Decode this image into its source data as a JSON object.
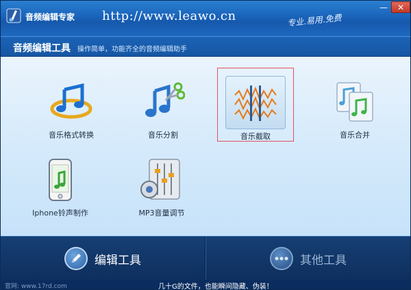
{
  "window": {
    "app_title": "音频编辑专家",
    "url": "http://www.leawo.cn",
    "slogan": "专业.易用.免费",
    "minimize_icon": "minimize-icon",
    "close_icon": "close-icon"
  },
  "header": {
    "title": "音频编辑工具",
    "description": "操作简单，功能齐全的音频编辑助手"
  },
  "tools": [
    {
      "label": "音乐格式转换",
      "icon": "music-convert-icon"
    },
    {
      "label": "音乐分割",
      "icon": "music-split-icon"
    },
    {
      "label": "音乐截取",
      "icon": "music-trim-icon",
      "selected": true
    },
    {
      "label": "音乐合并",
      "icon": "music-merge-icon"
    },
    {
      "label": "Iphone铃声制作",
      "icon": "iphone-ringtone-icon"
    },
    {
      "label": "MP3音量调节",
      "icon": "mp3-volume-icon"
    }
  ],
  "nav": {
    "edit_tools": "编辑工具",
    "other_tools": "其他工具"
  },
  "status": {
    "left": "官网: www.17rd.com",
    "link": "几十G的文件，也能瞬间隐藏、伪装！"
  },
  "colors": {
    "titlebar": "#1b67bd",
    "content_bg": "#d7ebfb",
    "bottom_bg": "#123766",
    "highlight": "#e05060"
  }
}
